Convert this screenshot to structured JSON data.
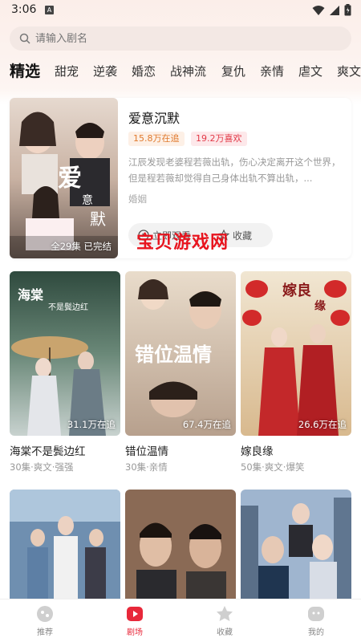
{
  "status": {
    "time": "3:06",
    "notif": "A"
  },
  "search": {
    "placeholder": "请输入剧名"
  },
  "tabs": [
    "精选",
    "甜宠",
    "逆袭",
    "婚恋",
    "战神流",
    "复仇",
    "亲情",
    "虐文",
    "爽文"
  ],
  "featured": {
    "title": "爱意沉默",
    "follow_badge": "15.8万在追",
    "like_badge": "19.2万喜欢",
    "description": "江辰发现老婆程若薇出轨，伤心决定离开这个世界，但是程若薇却觉得自己身体出轨不算出轨，...",
    "tag": "婚姻",
    "poster_caption": "全29集 已完结",
    "play_label": "立即观看",
    "collect_label": "收藏",
    "poster_title_art": "爱意沉默"
  },
  "watermark": "宝贝游戏网",
  "dramas": [
    {
      "title": "海棠不是鬓边红",
      "count": "31.1万在追",
      "meta": "30集·爽文·强强",
      "poster_art": "海棠不是鬓边红"
    },
    {
      "title": "错位温情",
      "count": "67.4万在追",
      "meta": "30集·亲情",
      "poster_art": "错位温情"
    },
    {
      "title": "嫁良缘",
      "count": "26.6万在追",
      "meta": "50集·爽文·爆笑",
      "poster_art": "嫁良缘"
    }
  ],
  "nav": [
    {
      "label": "推荐",
      "icon": "recommend-icon"
    },
    {
      "label": "剧场",
      "icon": "theater-play-icon"
    },
    {
      "label": "收藏",
      "icon": "collect-star-icon"
    },
    {
      "label": "我的",
      "icon": "profile-icon"
    }
  ],
  "colors": {
    "accent": "#e8283a",
    "follow": "#e07a2e",
    "like": "#e23a48"
  }
}
